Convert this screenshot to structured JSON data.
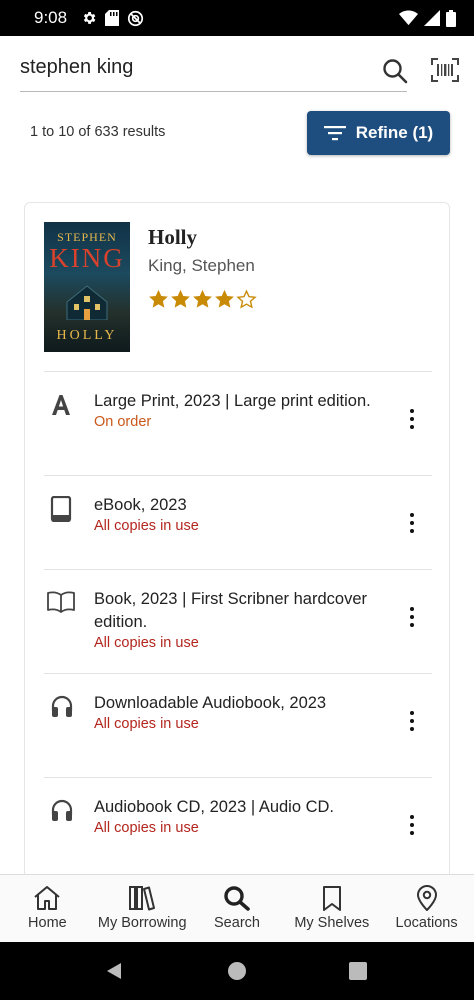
{
  "status_bar": {
    "time": "9:08"
  },
  "search": {
    "query": "stephen king"
  },
  "results": {
    "count_text": "1 to 10 of 633 results",
    "refine_label": "Refine (1)"
  },
  "book": {
    "title": "Holly",
    "author": "King, Stephen",
    "cover": {
      "author_text": "STEPHEN",
      "king_text": "KING",
      "title_text": "HOLLY"
    },
    "rating": {
      "stars": 4,
      "max": 5
    },
    "formats": [
      {
        "icon": "large-print-icon",
        "label": "Large Print, 2023 | Large print edition.",
        "status": "On order"
      },
      {
        "icon": "tablet-icon",
        "label": "eBook, 2023",
        "status": "All copies in use"
      },
      {
        "icon": "open-book-icon",
        "label": "Book, 2023 | First Scribner hardcover edition.",
        "status": "All copies in use"
      },
      {
        "icon": "headphones-icon",
        "label": "Downloadable Audiobook, 2023",
        "status": "All copies in use"
      },
      {
        "icon": "headphones-icon",
        "label": "Audiobook CD, 2023 | Audio CD.",
        "status": "All copies in use"
      }
    ]
  },
  "bottom_nav": [
    {
      "label": "Home",
      "icon": "home-icon"
    },
    {
      "label": "My Borrowing",
      "icon": "books-icon"
    },
    {
      "label": "Search",
      "icon": "search-icon"
    },
    {
      "label": "My Shelves",
      "icon": "bookmark-icon"
    },
    {
      "label": "Locations",
      "icon": "location-pin-icon"
    }
  ],
  "colors": {
    "accent": "#1d4e7f",
    "on_order": "#c9581a",
    "in_use": "#b3261e",
    "star": "#c98a06"
  }
}
